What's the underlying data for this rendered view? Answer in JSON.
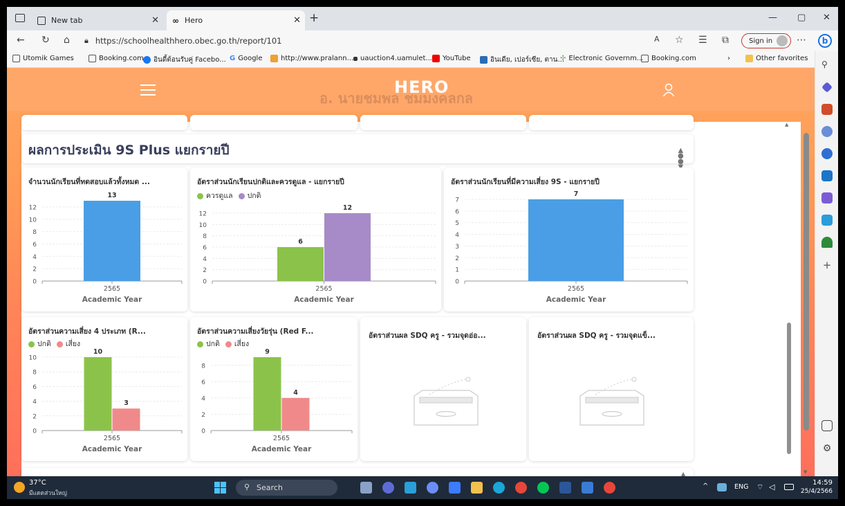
{
  "browser": {
    "tabs": [
      {
        "label": "New tab",
        "icon": "new-tab-icon"
      },
      {
        "label": "Hero",
        "icon": "hero-logo-icon"
      }
    ],
    "url": "https://schoolhealthhero.obec.go.th/report/101",
    "signin_label": "Sign in",
    "favorites": [
      "Utomik Games",
      "Booking.com",
      "อินดี้ต้อนรับคู่ Facebo...",
      "Google",
      "http://www.pralann...",
      "uauction4.uamulet...",
      "YouTube",
      "อินเดีย, เปอร์เซีย, ตาน...",
      "Electronic Governm...",
      "Booking.com"
    ],
    "other_favorites": "Other favorites"
  },
  "page": {
    "brand": "HERO",
    "ghost_text": "อ. นายชมพล ชมมงคลกล",
    "section_title": "ผลการประเมิน 9S Plus แยกรายปี",
    "accent_color": "#ffa769"
  },
  "charts": [
    {
      "title": "จำนวนนักเรียนที่ทดสอบแล้วทั้งหมด ...",
      "xlabel": "Academic Year",
      "chart_data": {
        "type": "bar",
        "categories": [
          "2565"
        ],
        "series": [
          {
            "values": [
              13
            ],
            "color": "#4a9ee5"
          }
        ],
        "ylim": [
          0,
          13
        ],
        "yticks": [
          0,
          2,
          4,
          6,
          8,
          10,
          12
        ]
      }
    },
    {
      "title": "อัตราส่วนนักเรียนปกติและควรดูแล - แยกรายปี",
      "xlabel": "Academic Year",
      "legend": [
        "ควรดูแล",
        "ปกติ"
      ],
      "chart_data": {
        "type": "bar",
        "categories": [
          "2565"
        ],
        "series": [
          {
            "name": "ควรดูแล",
            "values": [
              6
            ],
            "color": "#8bc34a"
          },
          {
            "name": "ปกติ",
            "values": [
              12
            ],
            "color": "#a78bc8"
          }
        ],
        "ylim": [
          0,
          12
        ],
        "yticks": [
          0,
          2,
          4,
          6,
          8,
          10,
          12
        ]
      }
    },
    {
      "title": "อัตราส่วนนักเรียนที่มีความเสี่ยง 9S - แยกรายปี",
      "xlabel": "Academic Year",
      "chart_data": {
        "type": "bar",
        "categories": [
          "2565"
        ],
        "series": [
          {
            "values": [
              7
            ],
            "color": "#4a9ee5"
          }
        ],
        "ylim": [
          0,
          7
        ],
        "yticks": [
          0,
          1,
          2,
          3,
          4,
          5,
          6,
          7
        ]
      }
    },
    {
      "title": "อัตราส่วนความเสี่ยง 4 ประเภท (R...",
      "xlabel": "Academic Year",
      "legend": [
        "ปกติ",
        "เสี่ยง"
      ],
      "chart_data": {
        "type": "bar",
        "categories": [
          "2565"
        ],
        "series": [
          {
            "name": "ปกติ",
            "values": [
              10
            ],
            "color": "#8bc34a"
          },
          {
            "name": "เสี่ยง",
            "values": [
              3
            ],
            "color": "#f08a8a"
          }
        ],
        "ylim": [
          0,
          10
        ],
        "yticks": [
          0,
          2,
          4,
          6,
          8,
          10
        ]
      }
    },
    {
      "title": "อัตราส่วนความเสี่ยงวัยรุ่น (Red F...",
      "xlabel": "Academic Year",
      "legend": [
        "ปกติ",
        "เสี่ยง"
      ],
      "chart_data": {
        "type": "bar",
        "categories": [
          "2565"
        ],
        "series": [
          {
            "name": "ปกติ",
            "values": [
              9
            ],
            "color": "#8bc34a"
          },
          {
            "name": "เสี่ยง",
            "values": [
              4
            ],
            "color": "#f08a8a"
          }
        ],
        "ylim": [
          0,
          9
        ],
        "yticks": [
          0,
          2,
          4,
          6,
          8
        ]
      }
    }
  ],
  "empty_cards": [
    {
      "title": "อัตราส่วนผล SDQ ครู - รวมจุดอ่อ..."
    },
    {
      "title": "อัตราส่วนผล SDQ ครู - รวมจุดแข็..."
    }
  ],
  "taskbar": {
    "weather_temp": "37°C",
    "weather_desc": "มีแดดส่วนใหญ่",
    "search_label": "Search",
    "lang": "ENG",
    "time": "14:59",
    "date": "25/4/2566"
  }
}
